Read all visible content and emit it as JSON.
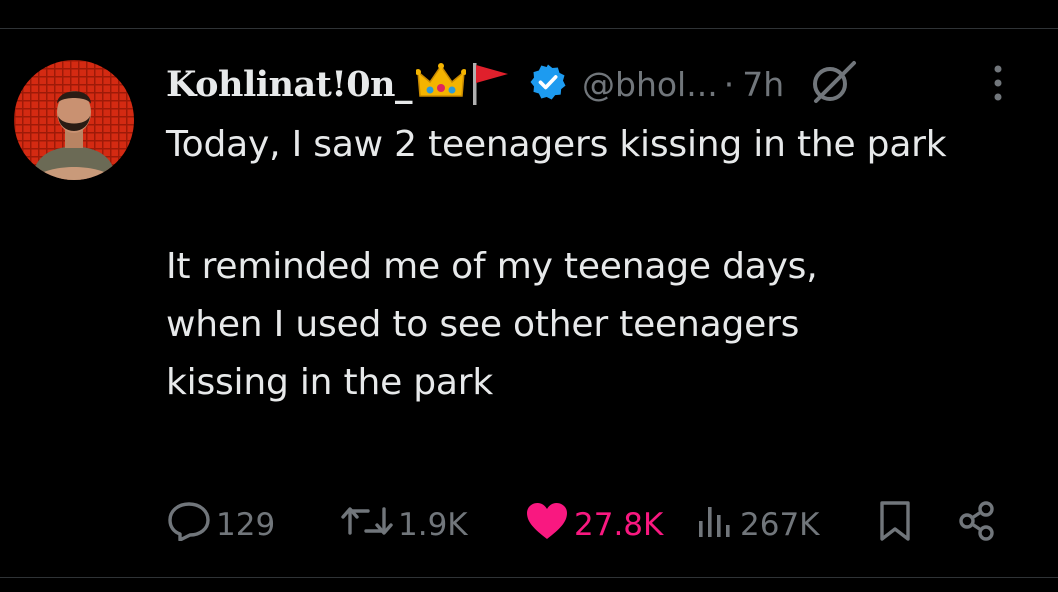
{
  "post": {
    "author": {
      "display_name": "Kohlinat!0n_",
      "emoji": [
        "crown-emoji",
        "red-flag-emoji"
      ],
      "verified": true,
      "handle": "@bhol...",
      "separator": "·",
      "time": "7h"
    },
    "text_lines": [
      "Today, I saw 2 teenagers kissing in the park",
      "It reminded me of my teenage days, when I used to see other teenagers kissing in the park"
    ],
    "stats": {
      "replies": "129",
      "reposts": "1.9K",
      "likes": "27.8K",
      "views": "267K"
    }
  },
  "colors": {
    "background": "#000000",
    "text": "#e7e9ea",
    "muted": "#71767b",
    "like": "#f91880",
    "verified": "#1d9bf0"
  },
  "icons": {
    "reply": "comment-icon",
    "repost": "repost-icon",
    "like": "heart-icon",
    "views": "views-chart-icon",
    "bookmark": "bookmark-icon",
    "share": "share-icon",
    "more": "more-dots-icon",
    "noedit": "grok-icon"
  }
}
